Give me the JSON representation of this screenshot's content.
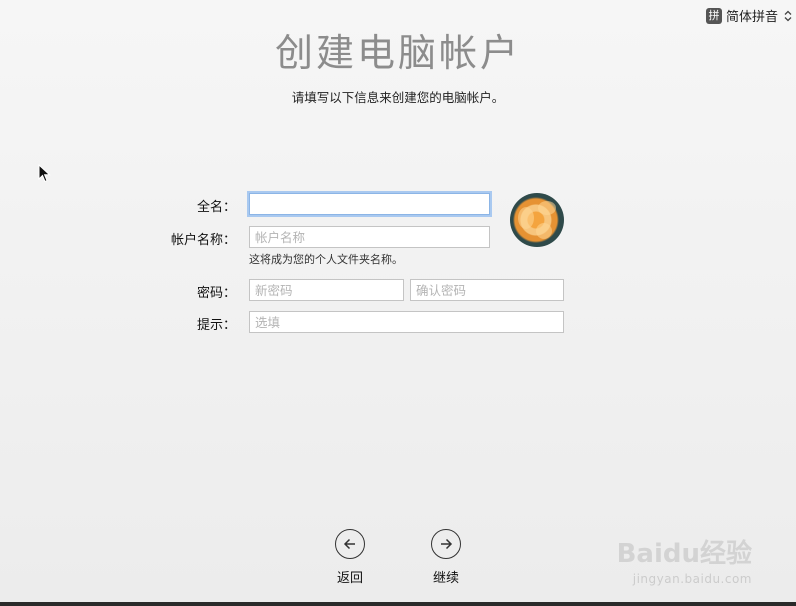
{
  "ime": {
    "badge": "拼",
    "label": "简体拼音"
  },
  "title": "创建电脑帐户",
  "subtitle": "请填写以下信息来创建您的电脑帐户。",
  "form": {
    "fullname_label": "全名：",
    "fullname_value": "",
    "account_label": "帐户名称：",
    "account_placeholder": "帐户名称",
    "account_hint": "这将成为您的个人文件夹名称。",
    "password_label": "密码：",
    "password_placeholder": "新密码",
    "verify_placeholder": "确认密码",
    "hint_label": "提示：",
    "hint_placeholder": "选填"
  },
  "nav": {
    "back_label": "返回",
    "continue_label": "继续"
  },
  "watermark": {
    "main": "Baidu经验",
    "sub": "jingyan.baidu.com"
  }
}
